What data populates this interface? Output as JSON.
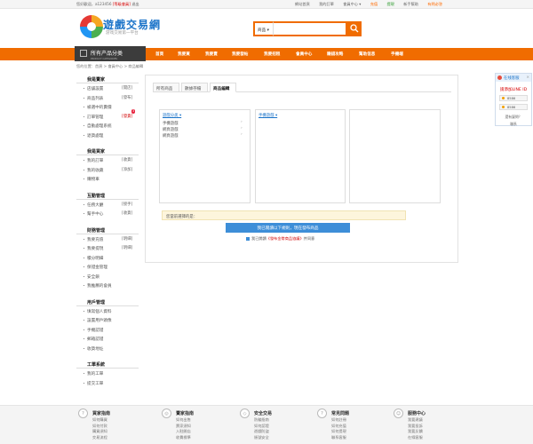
{
  "topbar": {
    "welcome": "您好歡迎，a123456",
    "upgrade": "[等级會員]",
    "logout": "退出",
    "links": [
      "網站首頁",
      "我的訂單",
      "會員中心 ▾",
      "充值",
      "提現",
      "新手幫助",
      "有問必答"
    ]
  },
  "brand": {
    "name": "遊戲交易網",
    "slogan": "游戏交易第一平台"
  },
  "search": {
    "select": "商品 ▾",
    "placeholder": "",
    "icon": "search-icon"
  },
  "category": {
    "label": "所有产品分类",
    "sub": "PRODUCT CATEGORIES"
  },
  "nav": [
    "首頁",
    "我要買",
    "我要賣",
    "我要發帖",
    "我要招租",
    "會員中心",
    "賺錢攻略",
    "幫助信息",
    "手機端"
  ],
  "breadcrumb": "您的位置：首頁 > 會員中心 > 商品編輯",
  "sidebar": [
    {
      "title": "我是賣家",
      "items": [
        {
          "label": "店舖設置",
          "tag": "[開店]"
        },
        {
          "label": "商品列表",
          "tag": "[發布]"
        },
        {
          "label": "被選中的賣價",
          "tag": ""
        },
        {
          "label": "訂單管理",
          "tag": "[發貨]",
          "badge": "3"
        },
        {
          "label": "自動處理系統",
          "tag": ""
        },
        {
          "label": "退貨處理",
          "tag": ""
        }
      ]
    },
    {
      "title": "我是買家",
      "items": [
        {
          "label": "我的訂單",
          "tag": "[收貨]"
        },
        {
          "label": "我的收藏",
          "tag": "[添加]"
        },
        {
          "label": "購物車",
          "tag": ""
        }
      ]
    },
    {
      "title": "互動管理",
      "items": [
        {
          "label": "任務大廳",
          "tag": "[接手]"
        },
        {
          "label": "幫手中心",
          "tag": "[收貨]"
        }
      ]
    },
    {
      "title": "財務管理",
      "items": [
        {
          "label": "我要充值",
          "tag": "[明細]"
        },
        {
          "label": "我要提現",
          "tag": "[明細]"
        },
        {
          "label": "積分明細",
          "tag": ""
        },
        {
          "label": "保證金管理",
          "tag": ""
        },
        {
          "label": "安全鎖",
          "tag": ""
        },
        {
          "label": "我推薦的會員",
          "tag": ""
        }
      ]
    },
    {
      "title": "用戶管理",
      "items": [
        {
          "label": "填寫個人資料",
          "tag": ""
        },
        {
          "label": "設置用戶頭像",
          "tag": ""
        },
        {
          "label": "手機認證",
          "tag": ""
        },
        {
          "label": "郵箱認證",
          "tag": ""
        },
        {
          "label": "收貨地址",
          "tag": ""
        }
      ]
    },
    {
      "title": "工單系統",
      "items": [
        {
          "label": "我的工單",
          "tag": ""
        },
        {
          "label": "提交工單",
          "tag": ""
        }
      ]
    }
  ],
  "tabs": [
    "所有商品",
    "數據存檔",
    "商品編輯"
  ],
  "active_tab": "商品編輯",
  "columns": {
    "c1": {
      "title": "遊戲分类 ▾",
      "rows": [
        "手機遊戲",
        "網頁遊戲",
        "網頁遊戲"
      ]
    },
    "c2": {
      "title": "手機遊戲 ▾",
      "rows": []
    },
    "c3": {
      "title": "",
      "rows": []
    }
  },
  "chosen_label": "您當前選擇的是：",
  "submit_label": "我已閱讀以下規則，現在發布商品",
  "agreement": {
    "prefix": "我已閱讀",
    "link": "《發布金幣商品協議》",
    "suffix": "并同意"
  },
  "chat": {
    "title": "在线客服",
    "line": "請添加LINE ID",
    "qq": [
      "8586",
      "8586"
    ],
    "footer1": "還有疑問？",
    "footer2": "聯系"
  },
  "footer": [
    {
      "title": "買家指南",
      "icon": "?",
      "items": [
        "如何購買",
        "如何付款",
        "購買須知",
        "交易流程"
      ]
    },
    {
      "title": "賣家指南",
      "icon": "◎",
      "items": [
        "如何出售",
        "賣家須知",
        "入駐開店",
        "收費標準"
      ]
    },
    {
      "title": "安全交易",
      "icon": "◇",
      "items": [
        "防騙指南",
        "如何認證",
        "遊戲防盜",
        "賬號安全"
      ]
    },
    {
      "title": "常見問題",
      "icon": "?",
      "items": [
        "如何註冊",
        "如何充值",
        "如何提現",
        "聯系客服"
      ]
    },
    {
      "title": "服務中心",
      "icon": "☺",
      "items": [
        "我要建議",
        "我要投訴",
        "我要反饋",
        "在線客服"
      ]
    }
  ],
  "colors": {
    "accent": "#f06c00",
    "link": "#1c74c9",
    "nav_dark": "#3c3c3c",
    "button": "#3d8ed8"
  }
}
